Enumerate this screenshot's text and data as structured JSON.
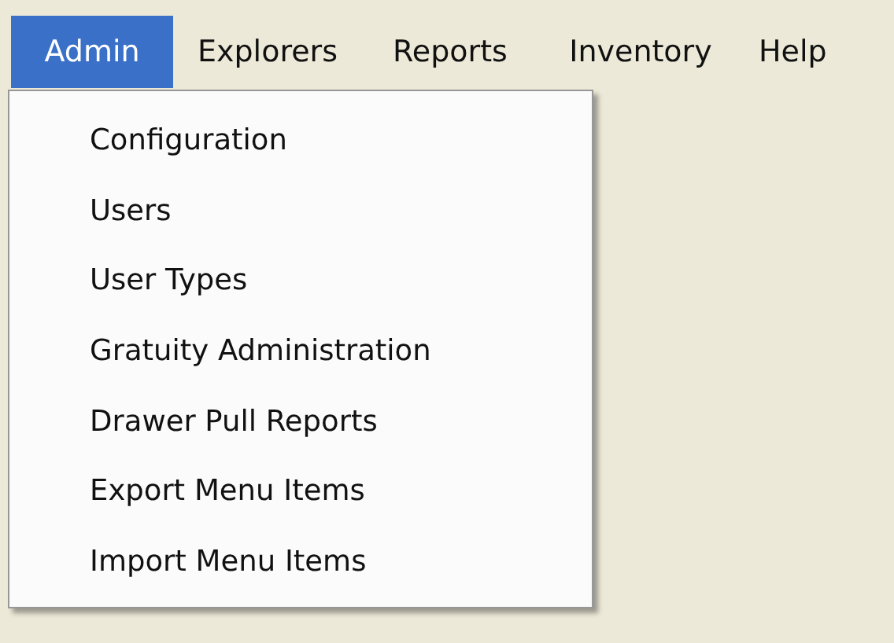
{
  "menu_bar": [
    {
      "label": "Admin",
      "selected": true
    },
    {
      "label": "Explorers",
      "selected": false
    },
    {
      "label": "Reports",
      "selected": false
    },
    {
      "label": "Inventory",
      "selected": false
    },
    {
      "label": "Help",
      "selected": false
    }
  ],
  "dropdown": {
    "items": [
      {
        "label": "Configuration"
      },
      {
        "label": "Users"
      },
      {
        "label": "User Types"
      },
      {
        "label": "Gratuity Administration"
      },
      {
        "label": "Drawer Pull Reports"
      },
      {
        "label": "Export Menu Items"
      },
      {
        "label": "Import Menu Items"
      }
    ]
  }
}
